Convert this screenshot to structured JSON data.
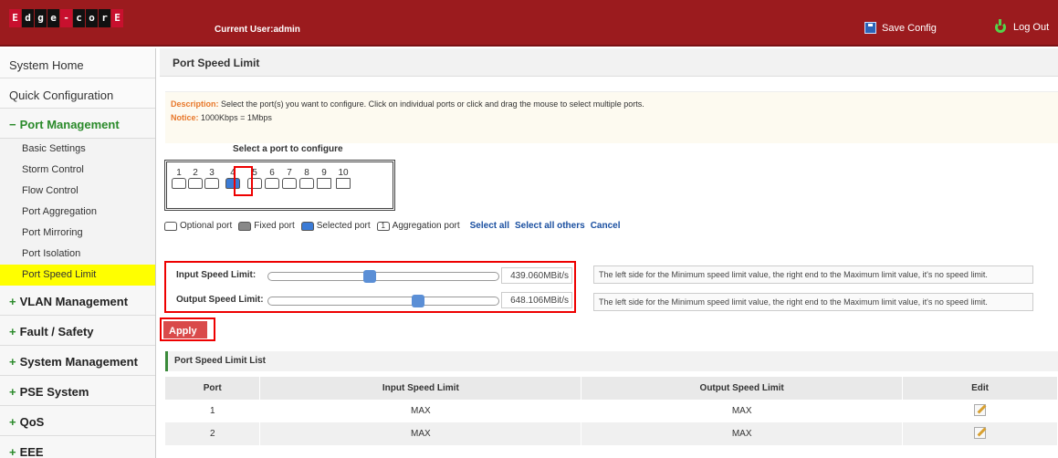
{
  "header": {
    "logo_letters": [
      "E",
      "d",
      "g",
      "e",
      "-",
      "c",
      "o",
      "r",
      "E"
    ],
    "current_user": "Current User:admin",
    "save_config": "Save Config",
    "log_out": "Log Out"
  },
  "sidebar": {
    "system_home": "System Home",
    "quick_config": "Quick Configuration",
    "port_management": "Port Management",
    "port_items": [
      "Basic Settings",
      "Storm Control",
      "Flow Control",
      "Port Aggregation",
      "Port Mirroring",
      "Port Isolation",
      "Port Speed Limit"
    ],
    "active_item": "Port Speed Limit",
    "sections": [
      "VLAN Management",
      "Fault / Safety",
      "System Management",
      "PSE System",
      "QoS",
      "EEE"
    ]
  },
  "main": {
    "title": "Port Speed Limit",
    "description_label": "Description:",
    "description_text": "Select the port(s) you want to configure. Click on individual ports or click and drag the mouse to select multiple ports.",
    "notice_label": "Notice:",
    "notice_text": "1000Kbps = 1Mbps",
    "select_title": "Select a port to configure",
    "ports": [
      "1",
      "2",
      "3",
      "4",
      "5",
      "6",
      "7",
      "8",
      "9",
      "10"
    ],
    "selected_port": "4",
    "legend": {
      "optional": "Optional port",
      "fixed": "Fixed port",
      "selected": "Selected port",
      "aggregation": "Aggregation port",
      "aggregation_icon_text": "1",
      "select_all": "Select all",
      "select_all_others": "Select all others",
      "cancel": "Cancel"
    },
    "input_speed": {
      "label": "Input Speed Limit:",
      "value": "439.060MBit/s",
      "slider_fraction": 0.44,
      "hint": "The left side for the Minimum speed limit value, the right end to the Maximum limit value, it's no speed limit."
    },
    "output_speed": {
      "label": "Output Speed Limit:",
      "value": "648.106MBit/s",
      "slider_fraction": 0.65,
      "hint": "The left side for the Minimum speed limit value, the right end to the Maximum limit value, it's no speed limit."
    },
    "apply": "Apply",
    "list_title": "Port Speed Limit List",
    "table": {
      "headers": [
        "Port",
        "Input Speed Limit",
        "Output Speed Limit",
        "Edit"
      ],
      "rows": [
        [
          "1",
          "MAX",
          "MAX"
        ],
        [
          "2",
          "MAX",
          "MAX"
        ]
      ]
    }
  },
  "colors": {
    "header_bg": "#9b1b1e",
    "active_nav": "#ffff00",
    "selected_port": "#3b7bd6",
    "apply_btn": "#d94a4a",
    "highlight_outline": "#ee0000"
  }
}
